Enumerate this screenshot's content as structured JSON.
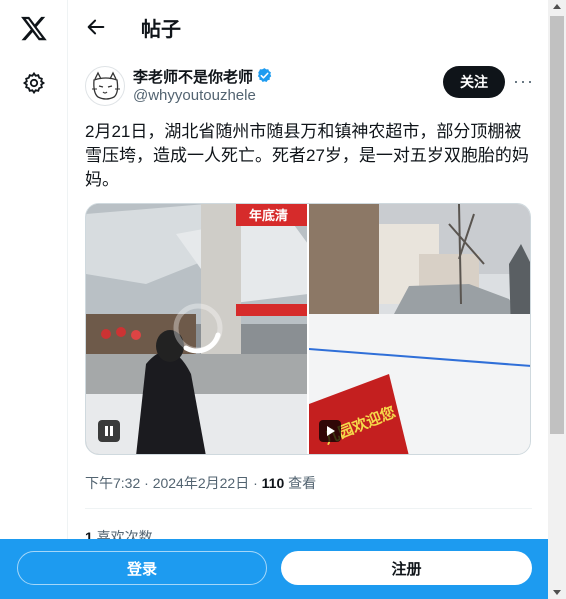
{
  "nav": {
    "logo_icon": "x-logo-icon",
    "settings_icon": "gear-icon"
  },
  "header": {
    "back_icon": "back-arrow-icon",
    "title": "帖子"
  },
  "post": {
    "author": {
      "display_name": "李老师不是你老师",
      "handle": "@whyyoutouzhele",
      "verified": true
    },
    "follow_label": "关注",
    "more_label": "···",
    "text": "2月21日，湖北省随州市随县万和镇神农超市，部分顶棚被雪压垮，造成一人死亡。死者27岁，是一对五岁双胞胎的妈妈。",
    "media": [
      {
        "type": "video",
        "control": "pause-icon",
        "sign_text": "年底清"
      },
      {
        "type": "video",
        "control": "play-icon",
        "sign_text": "儿园欢迎您"
      }
    ],
    "timestamp": "下午7:32 · 2024年2月22日 · ",
    "views_count": "110",
    "views_label": " 查看",
    "likes_count": "1",
    "likes_label": " 喜欢次数"
  },
  "bottom_bar": {
    "login_label": "登录",
    "signup_label": "注册"
  },
  "colors": {
    "accent": "#1d9bf0",
    "text": "#0f1419",
    "muted": "#536471"
  }
}
